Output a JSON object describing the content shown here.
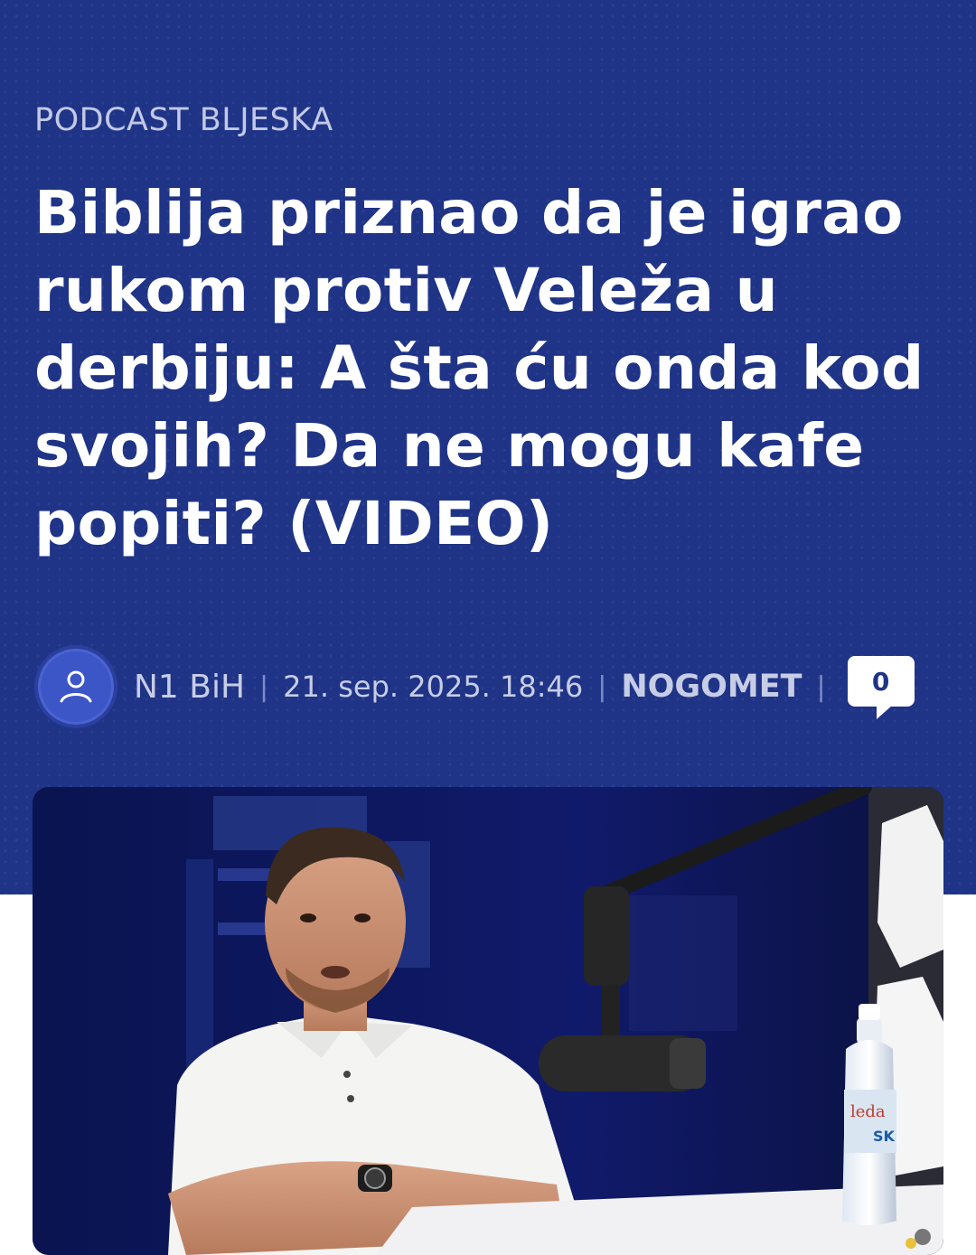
{
  "article": {
    "kicker": "PODCAST BLJESKA",
    "title": "Biblija priznao da je igrao rukom protiv Veleža u derbiju: A šta ću onda kod svojih? Da ne mogu kafe popiti? (VIDEO)",
    "author": "N1 BiH",
    "date": "21. sep. 2025. 18:46",
    "category": "NOGOMET",
    "comment_count": "0",
    "separator": "|"
  },
  "photo": {
    "bottle_label": "leda",
    "bottle_sublabel": "SK"
  },
  "colors": {
    "hero_bg": "#1f3487",
    "kicker_text": "#c2c9e6",
    "avatar_bg": "#3c55c7"
  },
  "icons": {
    "avatar": "user-icon",
    "comments": "comment-bubble-icon"
  }
}
